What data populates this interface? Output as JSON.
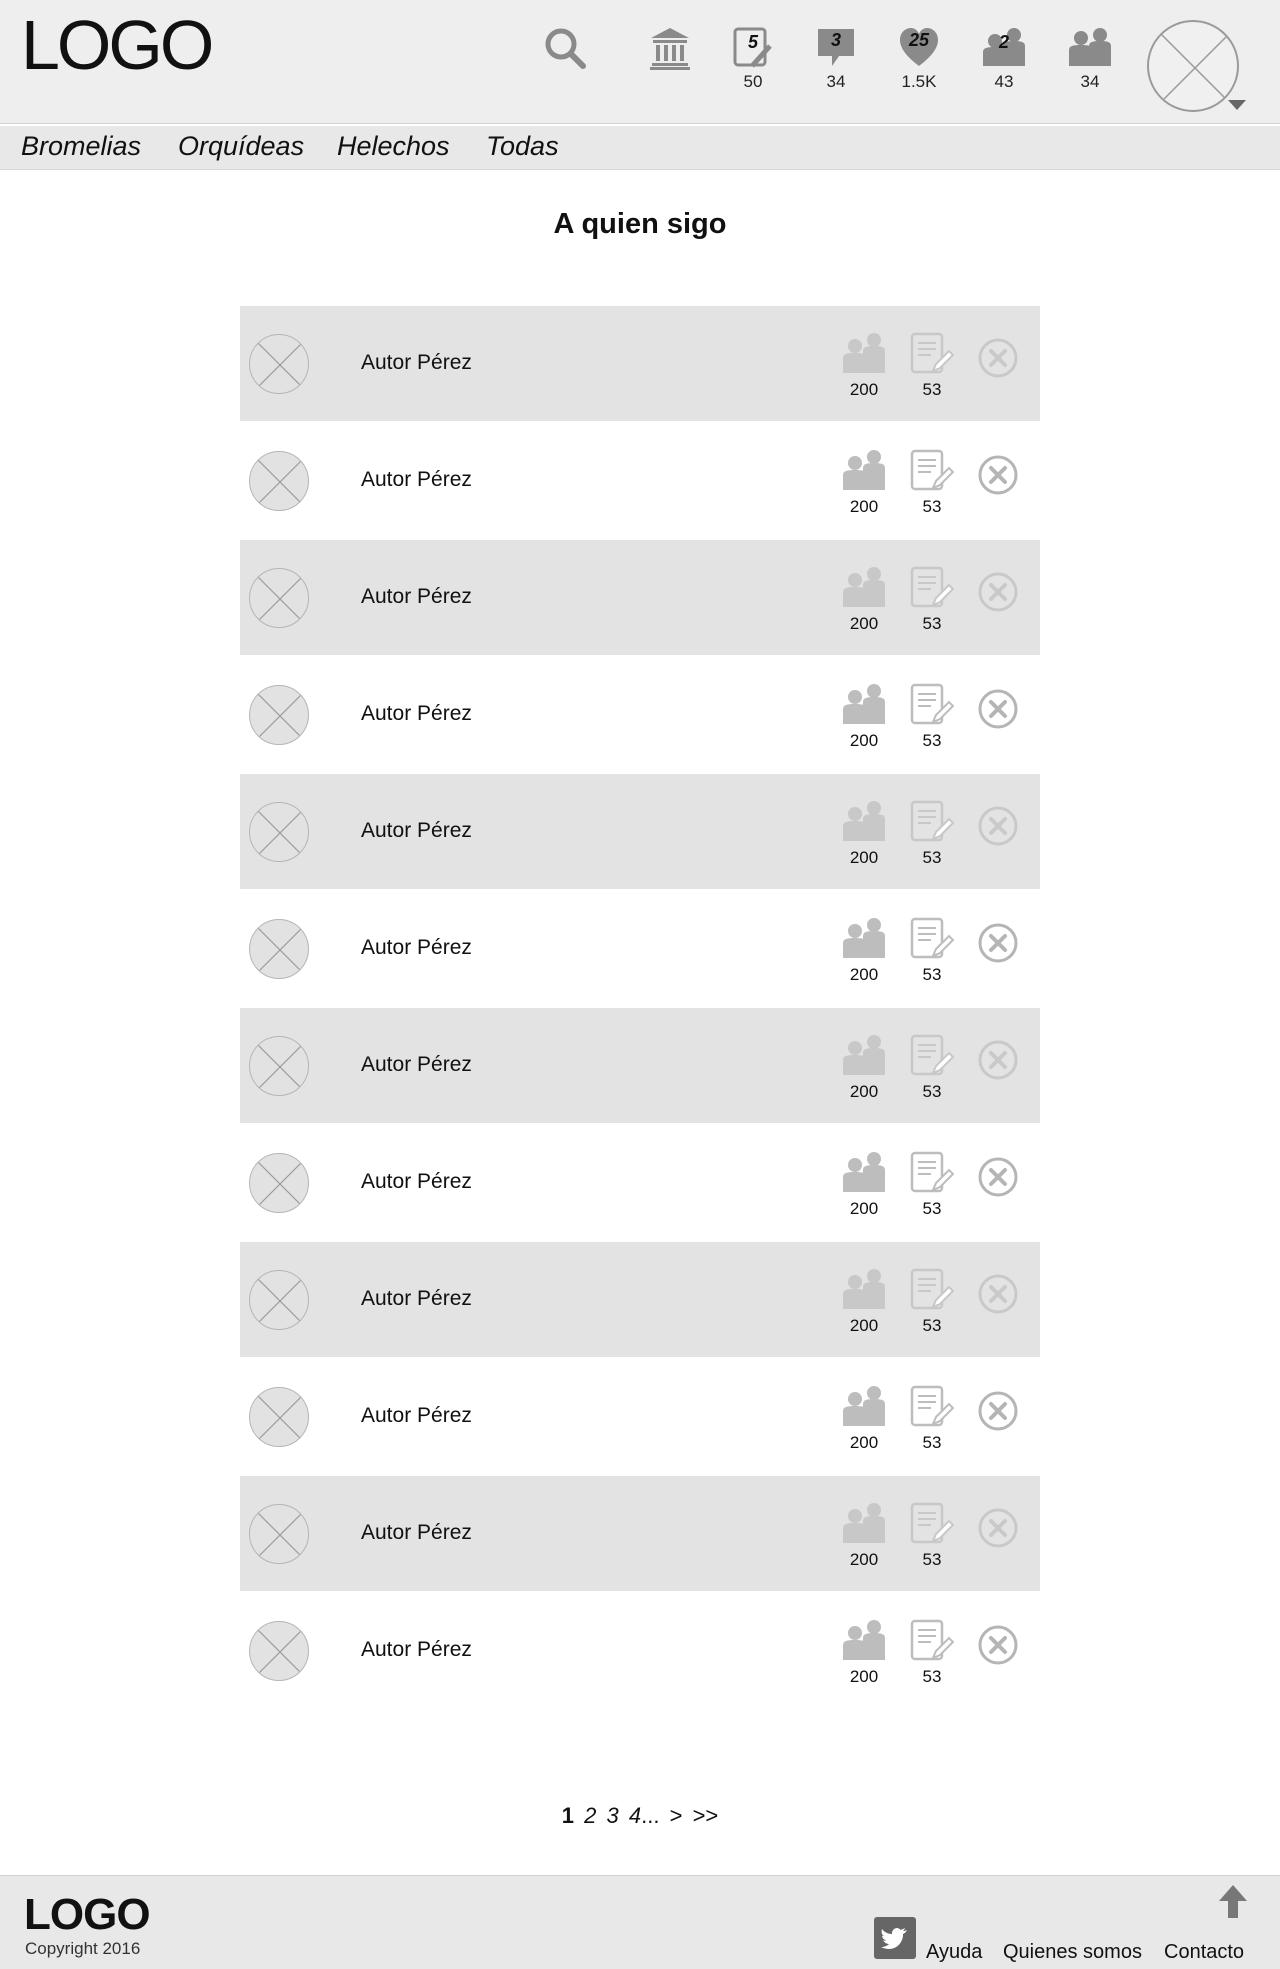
{
  "header": {
    "logo": "LOGO",
    "icons": [
      {
        "name": "search-icon"
      },
      {
        "name": "institution-icon"
      },
      {
        "name": "posts-icon",
        "badge": "5",
        "count": "50"
      },
      {
        "name": "messages-icon",
        "badge": "3",
        "count": "34"
      },
      {
        "name": "likes-icon",
        "badge": "25",
        "count": "1.5K"
      },
      {
        "name": "followers-icon",
        "badge": "2",
        "count": "43"
      },
      {
        "name": "following-icon",
        "count": "34"
      }
    ]
  },
  "categories": [
    "Bromelias",
    "Orquídeas",
    "Helechos",
    "Todas"
  ],
  "page_title": "A quien sigo",
  "authors": [
    {
      "name": "Autor Pérez",
      "followers": "200",
      "posts": "53"
    },
    {
      "name": "Autor Pérez",
      "followers": "200",
      "posts": "53"
    },
    {
      "name": "Autor Pérez",
      "followers": "200",
      "posts": "53"
    },
    {
      "name": "Autor Pérez",
      "followers": "200",
      "posts": "53"
    },
    {
      "name": "Autor Pérez",
      "followers": "200",
      "posts": "53"
    },
    {
      "name": "Autor Pérez",
      "followers": "200",
      "posts": "53"
    },
    {
      "name": "Autor Pérez",
      "followers": "200",
      "posts": "53"
    },
    {
      "name": "Autor Pérez",
      "followers": "200",
      "posts": "53"
    },
    {
      "name": "Autor Pérez",
      "followers": "200",
      "posts": "53"
    },
    {
      "name": "Autor Pérez",
      "followers": "200",
      "posts": "53"
    },
    {
      "name": "Autor Pérez",
      "followers": "200",
      "posts": "53"
    },
    {
      "name": "Autor Pérez",
      "followers": "200",
      "posts": "53"
    }
  ],
  "pagination": {
    "pages": [
      "1",
      "2",
      "3",
      "4"
    ],
    "current": "1",
    "ellipsis": "...",
    "next": ">",
    "last": ">>"
  },
  "footer": {
    "logo": "LOGO",
    "copyright": "Copyright 2016",
    "links": [
      "Ayuda",
      "Quienes somos",
      "Contacto"
    ]
  },
  "colors": {
    "icon_gray": "#888888",
    "row_shade": "#e3e3e3",
    "header_bg": "#eeeeee"
  }
}
